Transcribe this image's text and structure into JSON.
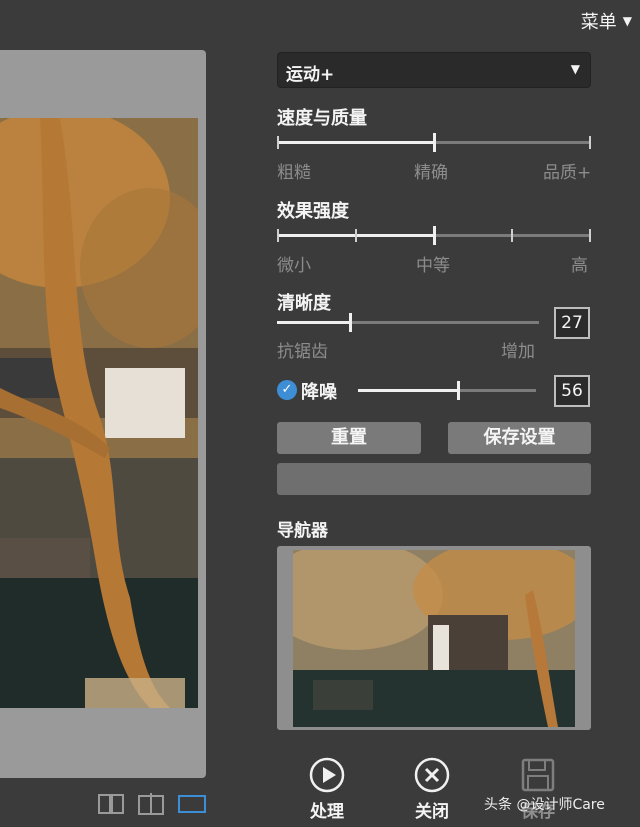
{
  "menu": {
    "label": "菜单"
  },
  "preset": {
    "value": "运动+"
  },
  "speed_quality": {
    "title": "速度与质量",
    "value": 0.5,
    "labels": [
      "粗糙",
      "精确",
      "品质+"
    ]
  },
  "effect_strength": {
    "title": "效果强度",
    "value": 0.5,
    "labels": [
      "微小",
      "中等",
      "高"
    ]
  },
  "sharpness": {
    "title": "清晰度",
    "value": "27",
    "labels": [
      "抗锯齿",
      "增加"
    ]
  },
  "denoise": {
    "label": "降噪",
    "checked": true,
    "value": "56"
  },
  "buttons": {
    "reset": "重置",
    "save_settings": "保存设置"
  },
  "navigator": {
    "title": "导航器"
  },
  "actions": {
    "process": "处理",
    "close": "关闭",
    "save": "保存"
  },
  "watermark": "头条 @设计师Care",
  "colors": {
    "background": "#3b3b3b",
    "accent": "#3e8ed6",
    "button": "#7a7a7a"
  }
}
